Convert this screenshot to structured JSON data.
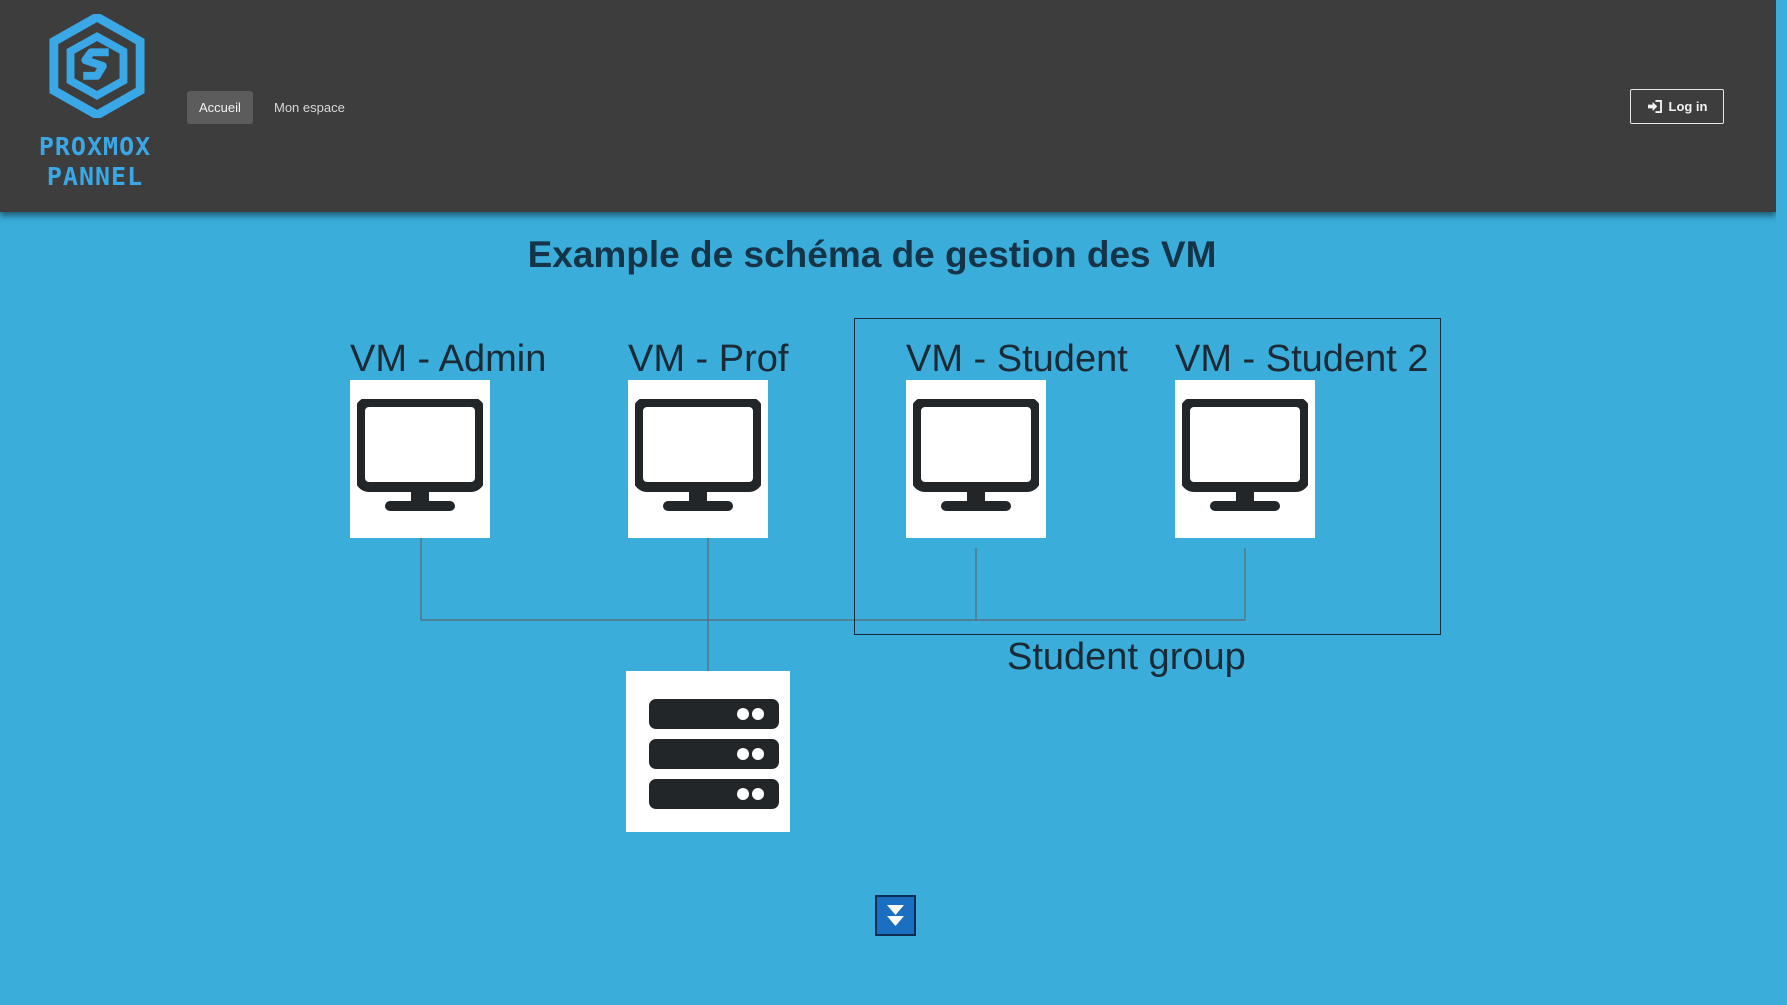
{
  "header": {
    "logo_text_line1": "PROXMOX",
    "logo_text_line2": "PANNEL",
    "nav": [
      {
        "label": "Accueil",
        "active": true
      },
      {
        "label": "Mon espace",
        "active": false
      }
    ],
    "login_label": "Log in"
  },
  "main": {
    "title": "Example de schéma de gestion des VM",
    "vms": [
      {
        "label": "VM - Admin"
      },
      {
        "label": "VM - Prof"
      },
      {
        "label": "VM - Student"
      },
      {
        "label": "VM - Student 2"
      }
    ],
    "group_label": "Student group"
  },
  "icons": {
    "logo": "proxmox-cube-logo",
    "login": "sign-in-icon",
    "vm": "desktop-monitor-icon",
    "server": "server-icon",
    "scroll": "double-chevron-down-icon"
  },
  "colors": {
    "page_background": "#3aaddb",
    "navbar_background": "#3d3d3d",
    "logo_accent": "#3aa8e6",
    "scroll_button": "#1a6fc0"
  }
}
